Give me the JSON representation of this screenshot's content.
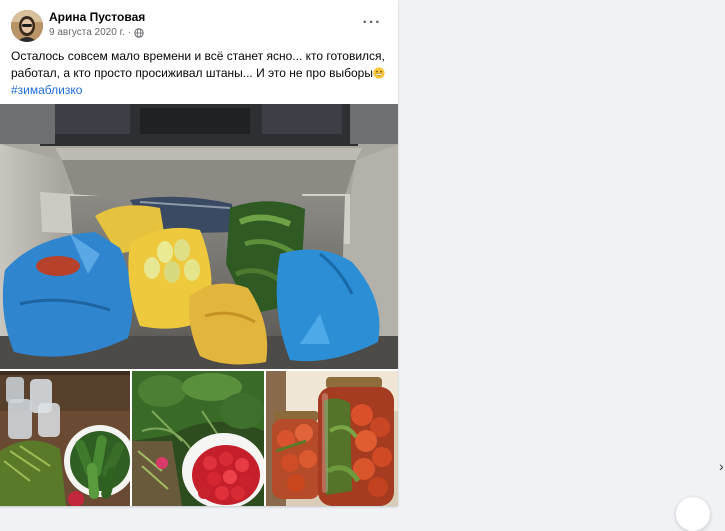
{
  "post": {
    "author_name": "Арина Пустовая",
    "date": "9 августа 2020 г.",
    "date_separator": "·",
    "text_line_1": "Осталось совсем мало времени и всё станет ясно... кто готовился,",
    "text_line_2": "работал, а кто просто просиживал штаны... И это не про выборы",
    "hashtag": "#зимаблизко",
    "more_label": "···",
    "privacy_icon": "globe-icon",
    "emoji_icon": "grinning-emoji-icon"
  },
  "photos": [
    {
      "name": "car-trunk-with-harvest-photo"
    },
    {
      "name": "cucumbers-and-jars-photo"
    },
    {
      "name": "greens-and-tomatoes-photo"
    },
    {
      "name": "canned-tomatoes-jars-photo"
    }
  ],
  "colors": {
    "page_background": "#f0f2f5",
    "card_background": "#ffffff",
    "hashtag": "#216fdb",
    "text_primary": "#050505",
    "text_secondary": "#65676b"
  }
}
